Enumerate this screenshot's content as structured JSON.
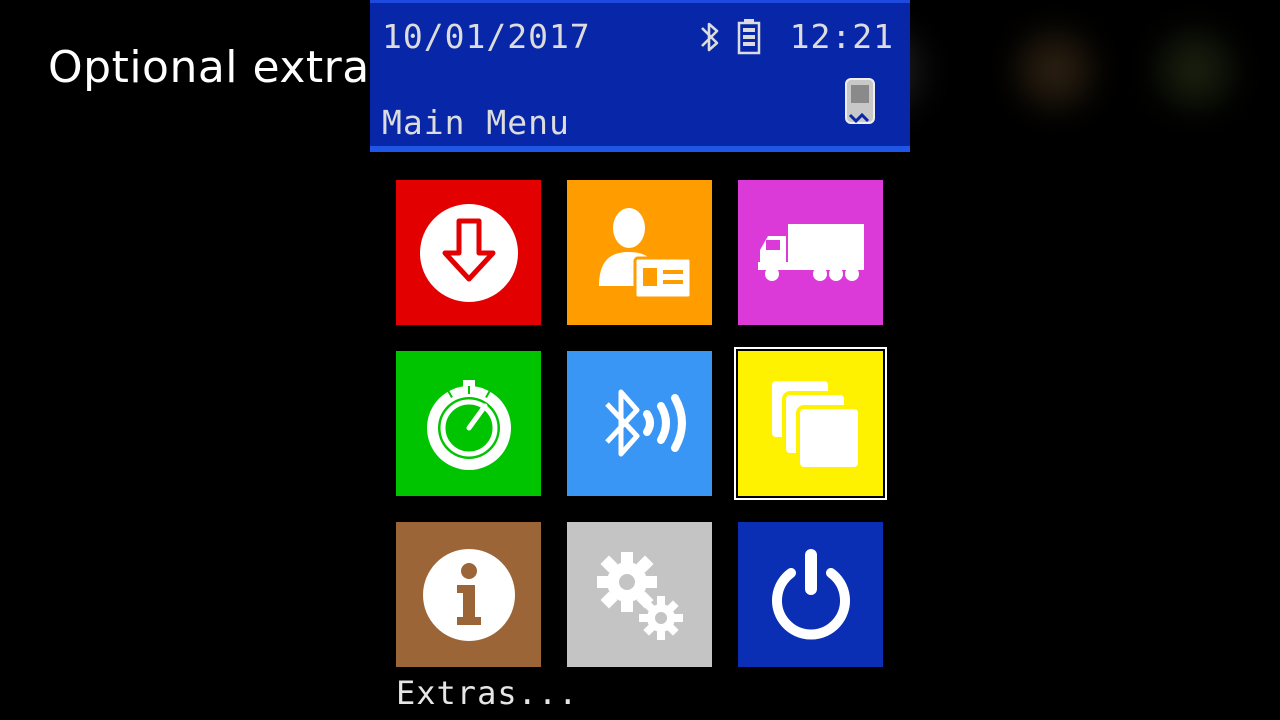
{
  "caption": "Optional extras",
  "status_bar": {
    "date": "10/01/2017",
    "time": "12:21",
    "title": "Main Menu",
    "icons": [
      "bluetooth-icon",
      "battery-icon",
      "handheld-device-icon"
    ]
  },
  "colors": {
    "header": "#0727a8",
    "download": "#e30000",
    "card": "#ff9c00",
    "truck": "#dc3ad8",
    "timer": "#00c400",
    "bluetooth": "#3a96f5",
    "extras": "#fff200",
    "info": "#9b6537",
    "settings": "#c4c4c4",
    "power": "#0a2fb5"
  },
  "tiles": [
    {
      "icon": "download-arrow-icon"
    },
    {
      "icon": "driver-card-icon"
    },
    {
      "icon": "truck-icon"
    },
    {
      "icon": "stopwatch-icon"
    },
    {
      "icon": "bluetooth-signal-icon"
    },
    {
      "icon": "extras-stack-icon",
      "selected": true
    },
    {
      "icon": "info-icon"
    },
    {
      "icon": "settings-gears-icon"
    },
    {
      "icon": "power-icon"
    }
  ],
  "footer_label": "Extras..."
}
